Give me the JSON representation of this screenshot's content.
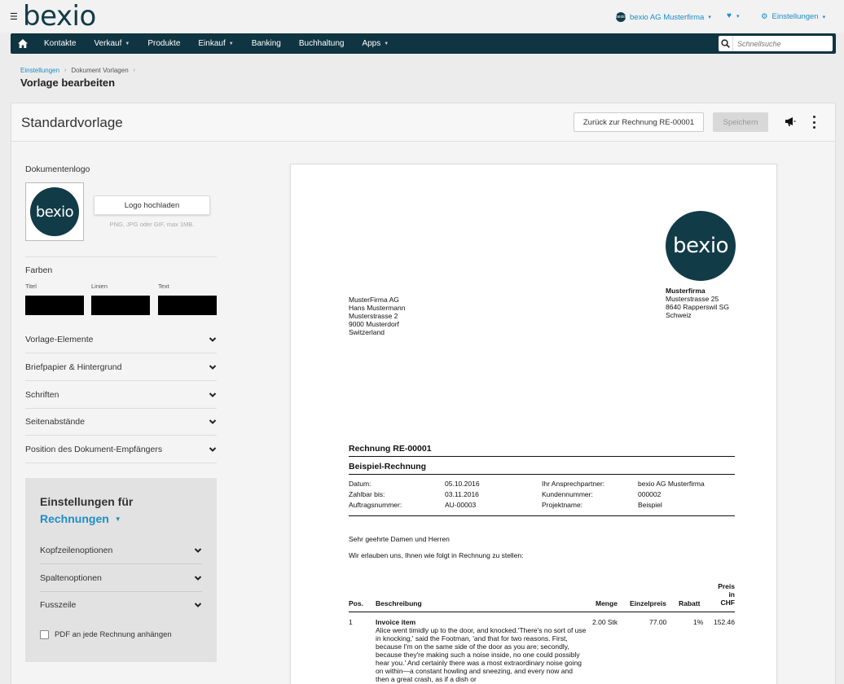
{
  "header": {
    "logo": "bexio",
    "company": "bexio AG Musterfirma",
    "company_avatar": "bexio",
    "settings": "Einstellungen"
  },
  "nav": {
    "items": [
      {
        "label": "Kontakte",
        "dropdown": false
      },
      {
        "label": "Verkauf",
        "dropdown": true
      },
      {
        "label": "Produkte",
        "dropdown": false
      },
      {
        "label": "Einkauf",
        "dropdown": true
      },
      {
        "label": "Banking",
        "dropdown": false
      },
      {
        "label": "Buchhaltung",
        "dropdown": false
      },
      {
        "label": "Apps",
        "dropdown": true
      }
    ],
    "search_placeholder": "Schnellsuche"
  },
  "breadcrumb": {
    "items": [
      "Einstellungen",
      "Dokument Vorlagen"
    ],
    "title": "Vorlage bearbeiten"
  },
  "toolbar": {
    "title": "Standardvorlage",
    "back_label": "Zurück zur Rechnung RE-00001",
    "save_label": "Speichern"
  },
  "sidebar": {
    "logo_label": "Dokumentenlogo",
    "logo_preview": "bexio",
    "upload_label": "Logo hochladen",
    "upload_hint": "PNG, JPG oder GIF, max 1MB.",
    "colors_label": "Farben",
    "colors": [
      {
        "label": "Titel",
        "value": "#000000"
      },
      {
        "label": "Linien",
        "value": "#000000"
      },
      {
        "label": "Text",
        "value": "#000000"
      }
    ],
    "sections": [
      "Vorlage-Elemente",
      "Briefpapier & Hintergrund",
      "Schriften",
      "Seitenabstände",
      "Position des Dokument-Empfängers"
    ],
    "settings_panel": {
      "title": "Einstellungen für",
      "doc_type": "Rechnungen",
      "sections": [
        "Kopfzeilenoptionen",
        "Spaltenoptionen",
        "Fusszeile"
      ],
      "checkbox_label": "PDF an jede Rechnung anhängen"
    }
  },
  "document": {
    "logo": "bexio",
    "sender": {
      "name": "Musterfirma",
      "lines": [
        "Musterstrasse 25",
        "8640 Rapperswil SG",
        "Schweiz"
      ]
    },
    "recipient": [
      "MusterFirma AG",
      "Hans Mustermann",
      "Musterstrasse 2",
      "9000 Musterdorf",
      "Switzerland"
    ],
    "title": "Rechnung RE-00001",
    "subtitle": "Beispiel-Rechnung",
    "meta_left": {
      "labels": [
        "Datum:",
        "Zahlbar bis:",
        "Auftragsnummer:"
      ],
      "values": [
        "05.10.2016",
        "03.11.2016",
        "AU-00003"
      ]
    },
    "meta_right": {
      "labels": [
        "Ihr Ansprechpartner:",
        "Kundennummer:",
        "Projektname:"
      ],
      "values": [
        "bexio AG Musterfirma",
        "000002",
        "Beispiel"
      ]
    },
    "greeting": "Sehr geehrte Damen und Herren",
    "intro": "Wir erlauben uns, Ihnen wie folgt in Rechnung zu stellen:",
    "table": {
      "headers": {
        "pos": "Pos.",
        "desc": "Beschreibung",
        "qty": "Menge",
        "unit": "Einzelpreis",
        "disc": "Rabatt",
        "price": [
          "Preis",
          "in",
          "CHF"
        ]
      },
      "rows": [
        {
          "pos": "1",
          "item": "Invoice item",
          "text": "Alice went timidly up to the door, and knocked.'There's no sort of use in knocking,' said the Footman, 'and that for two reasons. First, because I'm on the same side of the door as you are; secondly, because they're making such a noise inside, no one could possibly hear you.' And certainly there was a most extraordinary noise going on within—a constant howling and sneezing, and every now and then a great crash, as if a dish or",
          "qty": "2.00 Stk",
          "unit": "77.00",
          "disc": "1%",
          "price": "152.46"
        }
      ]
    }
  }
}
